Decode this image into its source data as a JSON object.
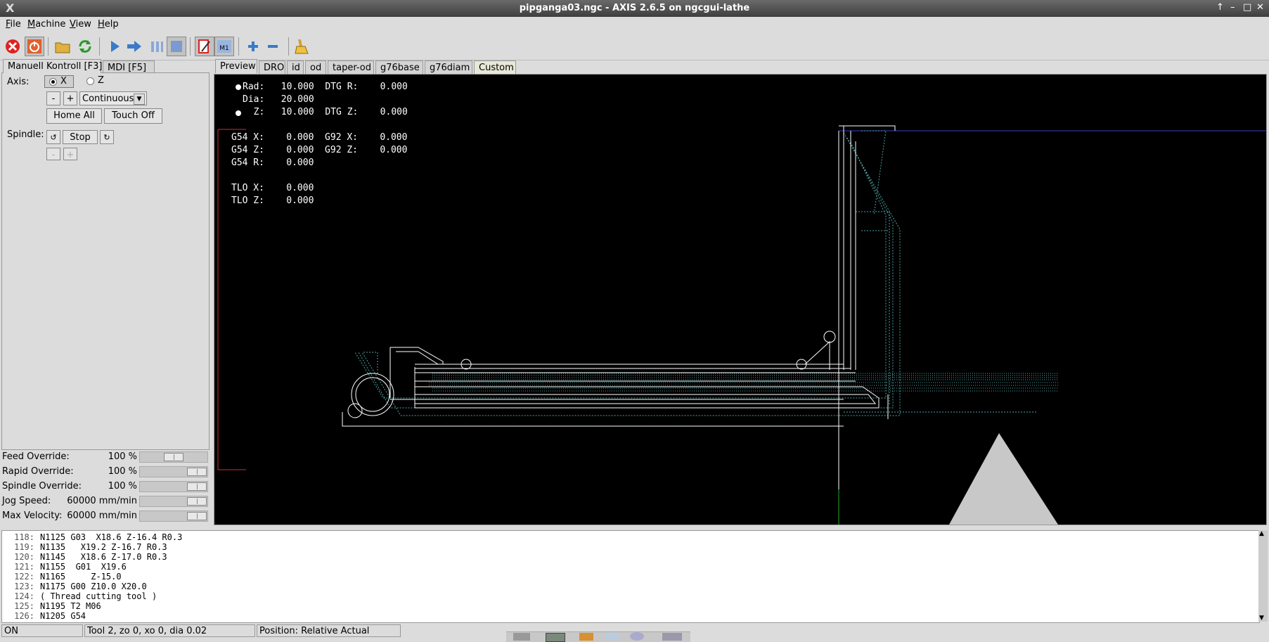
{
  "window": {
    "title": "pipganga03.ngc - AXIS 2.6.5 on ngcgui-lathe"
  },
  "menu": [
    "File",
    "Machine",
    "View",
    "Help"
  ],
  "toolbar": {
    "icons": [
      "estop-icon",
      "machine-power-icon",
      "open-file-icon",
      "reload-icon",
      "run-icon",
      "step-icon",
      "pause-icon",
      "stop-icon",
      "block-delete-icon",
      "optional-stop-icon",
      "zoom-in-icon",
      "zoom-out-icon",
      "clear-plot-icon"
    ]
  },
  "left_tabs": [
    "Manuell Kontroll [F3]",
    "MDI [F5]"
  ],
  "manual": {
    "axis_label": "Axis:",
    "axis_x": "X",
    "axis_z": "Z",
    "minus": "-",
    "plus": "+",
    "jog_mode": "Continuous",
    "home_all": "Home All",
    "touch_off": "Touch Off",
    "spindle_label": "Spindle:",
    "spindle_stop": "Stop"
  },
  "overrides": [
    {
      "label": "Feed Override:",
      "value": "100 %",
      "level": 0.5
    },
    {
      "label": "Rapid Override:",
      "value": "100 %",
      "level": 1.0
    },
    {
      "label": "Spindle Override:",
      "value": "100 %",
      "level": 1.0
    },
    {
      "label": "Jog Speed:",
      "value": "60000 mm/min",
      "level": 1.0
    },
    {
      "label": "Max Velocity:",
      "value": "60000 mm/min",
      "level": 1.0
    }
  ],
  "right_tabs": [
    "Preview",
    "DRO",
    "id",
    "od",
    "taper-od",
    "g76base",
    "g76diam",
    "Custom"
  ],
  "dro": {
    "rows": [
      "Rad:   10.000  DTG R:    0.000",
      "Dia:   20.000",
      "  Z:   10.000  DTG Z:    0.000",
      "G54 X:    0.000  G92 X:    0.000",
      "G54 Z:    0.000  G92 Z:    0.000",
      "G54 R:    0.000",
      "TLO X:    0.000",
      "TLO Z:    0.000"
    ]
  },
  "code": {
    "lines": [
      {
        "n": "118:",
        "t": "N1125 G03  X18.6 Z-16.4 R0.3"
      },
      {
        "n": "119:",
        "t": "N1135   X19.2 Z-16.7 R0.3"
      },
      {
        "n": "120:",
        "t": "N1145   X18.6 Z-17.0 R0.3"
      },
      {
        "n": "121:",
        "t": "N1155  G01  X19.6"
      },
      {
        "n": "122:",
        "t": "N1165     Z-15.0"
      },
      {
        "n": "123:",
        "t": "N1175 G00 Z10.0 X20.0"
      },
      {
        "n": "124:",
        "t": "( Thread cutting tool )"
      },
      {
        "n": "125:",
        "t": "N1195 T2 M06"
      },
      {
        "n": "126:",
        "t": "N1205 G54"
      }
    ]
  },
  "status": {
    "state": "ON",
    "tool": "Tool 2, zo 0, xo 0, dia 0.02",
    "position": "Position: Relative Actual"
  },
  "colors": {
    "preview_bg": "#000000",
    "path_feed": "#ffffff",
    "path_rapid": "#4fa3a3",
    "estop": "#d22222"
  }
}
